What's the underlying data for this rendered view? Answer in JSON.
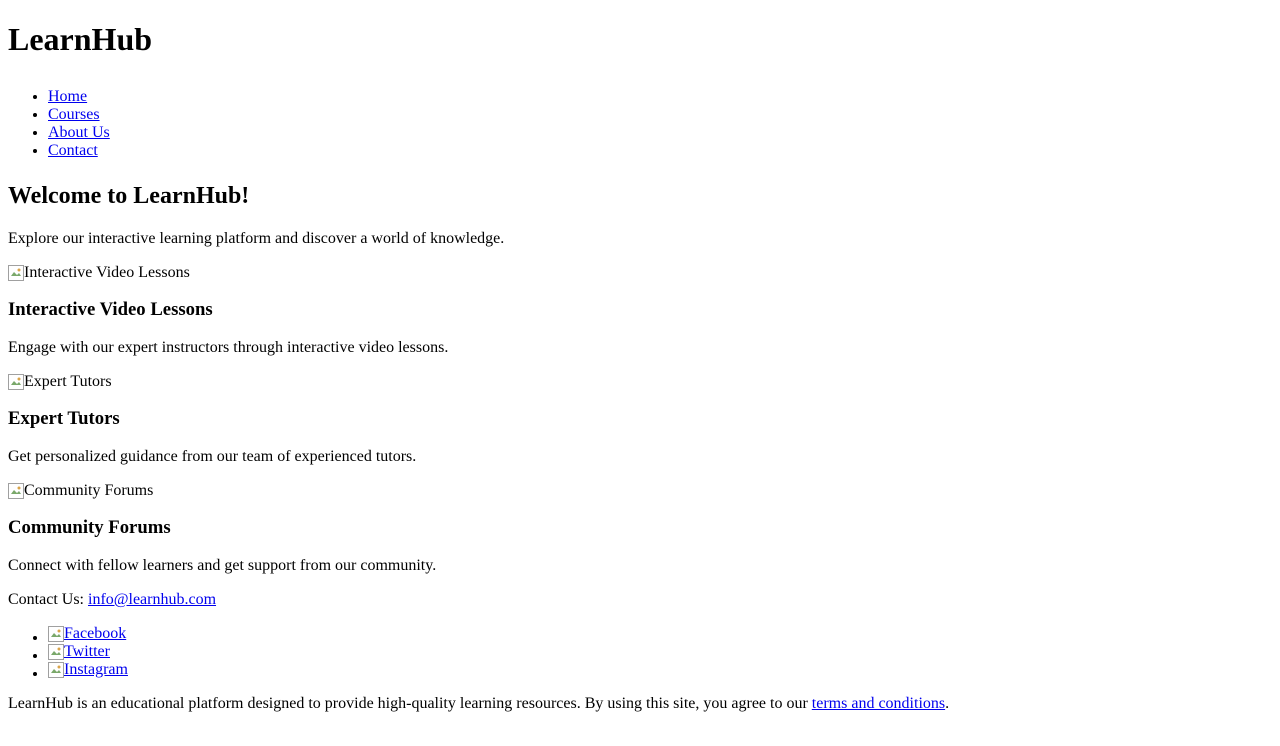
{
  "site": {
    "title": "LearnHub"
  },
  "nav": {
    "items": [
      {
        "label": "Home"
      },
      {
        "label": "Courses"
      },
      {
        "label": "About Us"
      },
      {
        "label": "Contact"
      }
    ]
  },
  "hero": {
    "heading": "Welcome to LearnHub!",
    "intro": "Explore our interactive learning platform and discover a world of knowledge."
  },
  "features": [
    {
      "image_alt": "Interactive Video Lessons",
      "title": "Interactive Video Lessons",
      "description": "Engage with our expert instructors through interactive video lessons."
    },
    {
      "image_alt": "Expert Tutors",
      "title": "Expert Tutors",
      "description": "Get personalized guidance from our team of experienced tutors."
    },
    {
      "image_alt": "Community Forums",
      "title": "Community Forums",
      "description": "Connect with fellow learners and get support from our community."
    }
  ],
  "contact": {
    "label": "Contact Us: ",
    "email": "info@learnhub.com"
  },
  "social": [
    {
      "label": "Facebook"
    },
    {
      "label": "Twitter"
    },
    {
      "label": "Instagram"
    }
  ],
  "footer": {
    "text": "LearnHub is an educational platform designed to provide high-quality learning resources. By using this site, you agree to our ",
    "link_label": "terms and conditions",
    "suffix": "."
  },
  "colors": {
    "link": "#0000ee",
    "text": "#000000",
    "background": "#ffffff"
  },
  "icons": {
    "broken_image": "broken-image-icon"
  }
}
